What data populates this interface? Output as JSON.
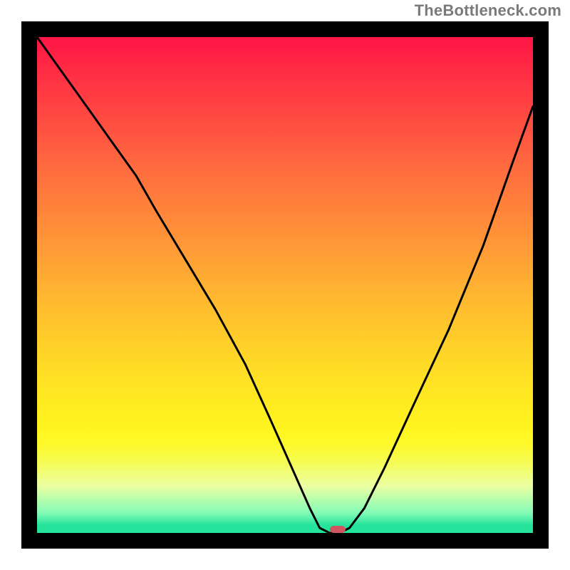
{
  "watermark": "TheBottleneck.com",
  "chart_data": {
    "type": "line",
    "title": "",
    "xlabel": "",
    "ylabel": "",
    "xlim": [
      0,
      100
    ],
    "ylim": [
      0,
      100
    ],
    "gradient_bands": [
      {
        "label": "red",
        "approx_value": 100,
        "color": "#ff1446"
      },
      {
        "label": "orange",
        "approx_value": 60,
        "color": "#ff9a36"
      },
      {
        "label": "yellow",
        "approx_value": 25,
        "color": "#ffef20"
      },
      {
        "label": "green",
        "approx_value": 0,
        "color": "#24e39b"
      }
    ],
    "series": [
      {
        "name": "bottleneck_curve",
        "x": [
          0,
          5,
          10,
          15,
          20,
          24,
          30,
          36,
          42,
          47,
          51,
          55,
          57,
          59,
          61,
          63,
          66,
          70,
          76,
          83,
          90,
          96,
          100
        ],
        "y": [
          100,
          93,
          86,
          79,
          72,
          65,
          55,
          45,
          34,
          23,
          14,
          5,
          1,
          0,
          0,
          1,
          5,
          13,
          26,
          41,
          58,
          75,
          86
        ]
      }
    ],
    "optimum_marker": {
      "x": 60,
      "y": 0,
      "color": "#cf5561"
    }
  }
}
